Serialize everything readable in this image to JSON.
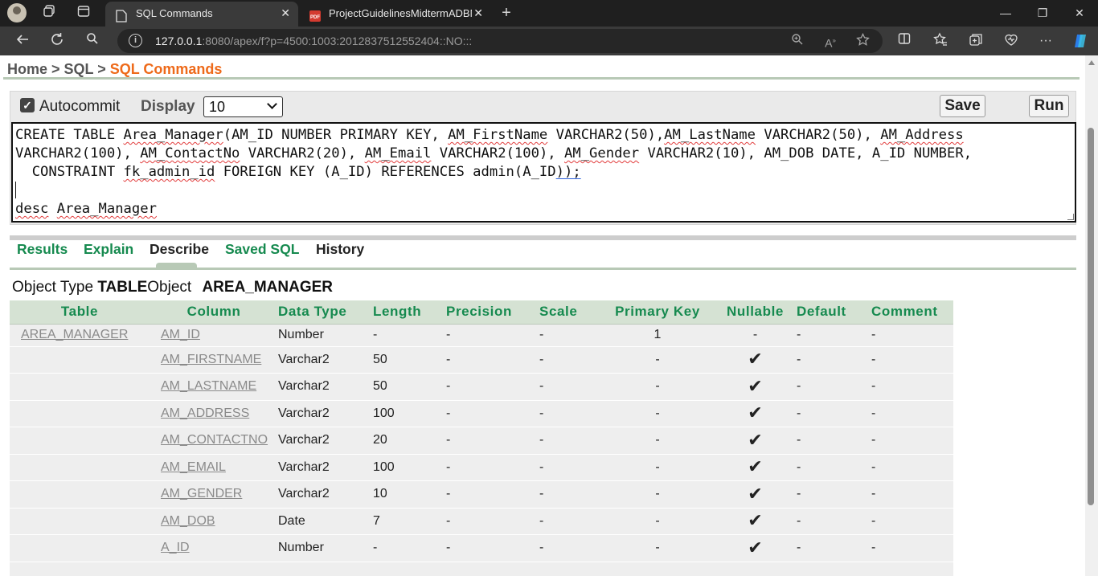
{
  "browser": {
    "tabs": [
      {
        "title": "SQL Commands",
        "active": true,
        "close": "✕"
      },
      {
        "title": "ProjectGuidelinesMidtermADBMS",
        "active": false,
        "close": "✕"
      }
    ],
    "new_tab": "+",
    "window_controls": {
      "minimize": "—",
      "restore": "❐",
      "close": "✕"
    },
    "url_host": "127.0.0.1",
    "url_rest": ":8080/apex/f?p=4500:1003:2012837512552404::NO:::"
  },
  "breadcrumb": {
    "home": "Home",
    "sep1": " > ",
    "sql": "SQL",
    "sep2": " > ",
    "current": "SQL Commands"
  },
  "toolbar": {
    "autocommit_label": "Autocommit",
    "autocommit_checked": true,
    "display_label": "Display",
    "display_value": "10",
    "save_label": "Save",
    "run_label": "Run"
  },
  "editor": {
    "line1_a": "CREATE TABLE ",
    "line1_b": "Area_Manager",
    "line1_c": "(AM_ID NUMBER PRIMARY KEY, ",
    "line1_d": "AM_FirstName",
    "line1_e": " VARCHAR2(50),",
    "line1_f": "AM_LastName",
    "line1_g": " VARCHAR2(50), ",
    "line1_h": "AM_Address",
    "line2_a": "VARCHAR2(100), ",
    "line2_b": "AM_ContactNo",
    "line2_c": " VARCHAR2(20), ",
    "line2_d": "AM_Email",
    "line2_e": " VARCHAR2(100), ",
    "line2_f": "AM_Gender",
    "line2_g": " VARCHAR2(10), AM_DOB DATE, A_ID NUMBER,",
    "line3_a": "  CONSTRAINT ",
    "line3_b": "fk_admin_id",
    "line3_c": " FOREIGN KEY (A_ID) REFERENCES admin(A_ID",
    "line3_d": "));",
    "line5_a": "desc",
    "line5_b": " ",
    "line5_c": "Area_Manager"
  },
  "result_tabs": [
    {
      "label": "Results",
      "active": false
    },
    {
      "label": "Explain",
      "active": false
    },
    {
      "label": "Describe",
      "active": true
    },
    {
      "label": "Saved SQL",
      "active": false
    },
    {
      "label": "History",
      "active": false
    }
  ],
  "object_info": {
    "type_label": "Object Type ",
    "type_value": "TABLE",
    "object_label": "Object ",
    "object_value": "AREA_MANAGER"
  },
  "describe_table": {
    "headers": [
      "Table",
      "Column",
      "Data Type",
      "Length",
      "Precision",
      "Scale",
      "Primary Key",
      "Nullable",
      "Default",
      "Comment"
    ],
    "table_name": "AREA_MANAGER",
    "rows": [
      {
        "column": "AM_ID",
        "data_type": "Number",
        "length": "-",
        "precision": "-",
        "scale": "-",
        "primary_key": "1",
        "nullable": "-",
        "default": "-",
        "comment": "-"
      },
      {
        "column": "AM_FIRSTNAME",
        "data_type": "Varchar2",
        "length": "50",
        "precision": "-",
        "scale": "-",
        "primary_key": "-",
        "nullable": "✔",
        "default": "-",
        "comment": "-"
      },
      {
        "column": "AM_LASTNAME",
        "data_type": "Varchar2",
        "length": "50",
        "precision": "-",
        "scale": "-",
        "primary_key": "-",
        "nullable": "✔",
        "default": "-",
        "comment": "-"
      },
      {
        "column": "AM_ADDRESS",
        "data_type": "Varchar2",
        "length": "100",
        "precision": "-",
        "scale": "-",
        "primary_key": "-",
        "nullable": "✔",
        "default": "-",
        "comment": "-"
      },
      {
        "column": "AM_CONTACTNO",
        "data_type": "Varchar2",
        "length": "20",
        "precision": "-",
        "scale": "-",
        "primary_key": "-",
        "nullable": "✔",
        "default": "-",
        "comment": "-"
      },
      {
        "column": "AM_EMAIL",
        "data_type": "Varchar2",
        "length": "100",
        "precision": "-",
        "scale": "-",
        "primary_key": "-",
        "nullable": "✔",
        "default": "-",
        "comment": "-"
      },
      {
        "column": "AM_GENDER",
        "data_type": "Varchar2",
        "length": "10",
        "precision": "-",
        "scale": "-",
        "primary_key": "-",
        "nullable": "✔",
        "default": "-",
        "comment": "-"
      },
      {
        "column": "AM_DOB",
        "data_type": "Date",
        "length": "7",
        "precision": "-",
        "scale": "-",
        "primary_key": "-",
        "nullable": "✔",
        "default": "-",
        "comment": "-"
      },
      {
        "column": "A_ID",
        "data_type": "Number",
        "length": "-",
        "precision": "-",
        "scale": "-",
        "primary_key": "-",
        "nullable": "✔",
        "default": "-",
        "comment": "-"
      }
    ]
  },
  "colors": {
    "accent_green": "#168a4f",
    "breadcrumb_current": "#ee6a1a",
    "table_header_bg": "#d5e2d3"
  }
}
